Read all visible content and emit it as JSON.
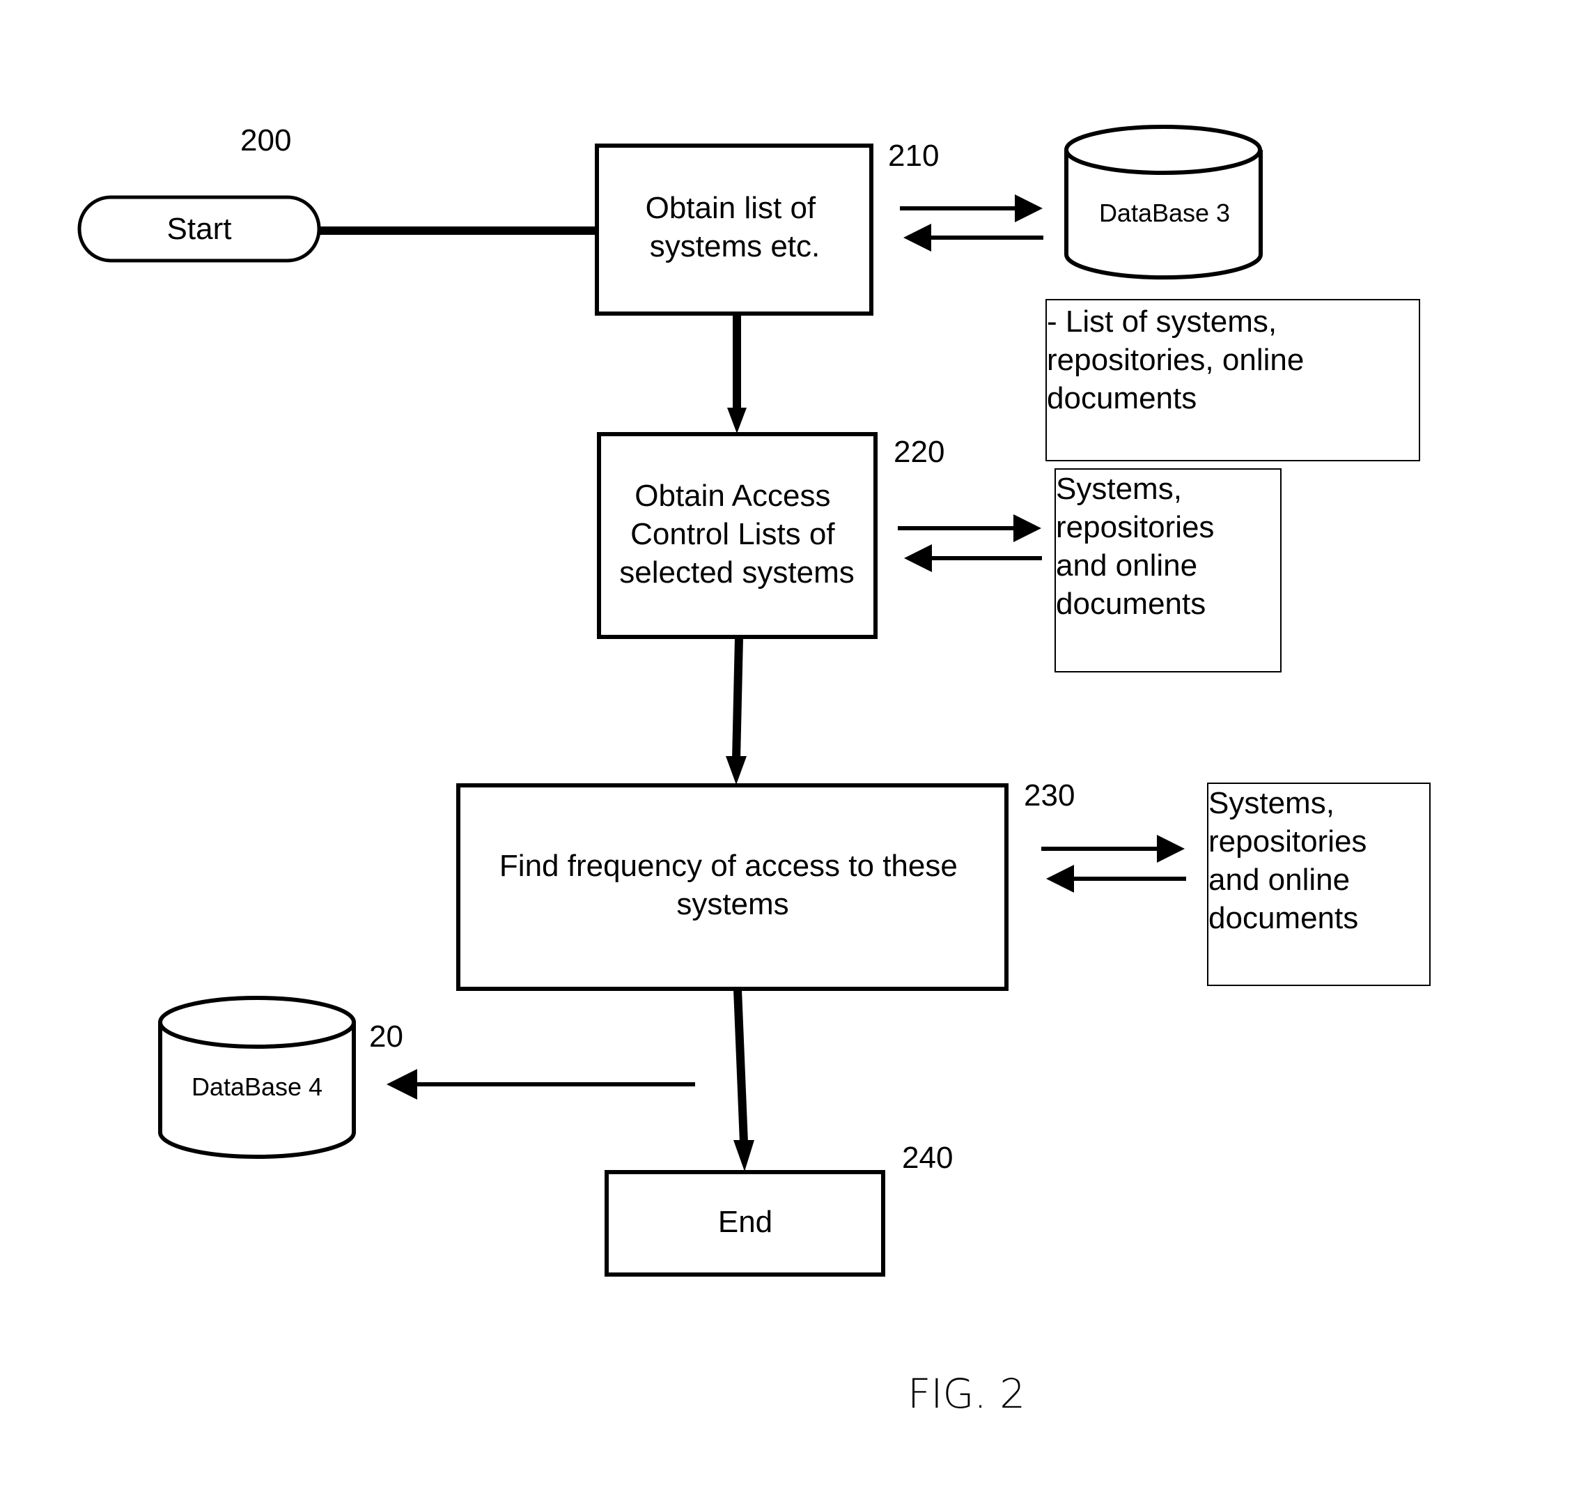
{
  "figure": {
    "caption": "FIG. 2",
    "diagram_ref": "200"
  },
  "nodes": {
    "start": {
      "label": "Start"
    },
    "step210": {
      "ref": "210",
      "lines": [
        "Obtain list of",
        "systems etc."
      ]
    },
    "step220": {
      "ref": "220",
      "lines": [
        "Obtain Access",
        "Control Lists of",
        "selected systems"
      ]
    },
    "step230": {
      "ref": "230",
      "lines": [
        "Find frequency of access to these",
        "systems"
      ]
    },
    "end": {
      "ref": "240",
      "label": "End"
    }
  },
  "databases": {
    "db3": {
      "label": "DataBase 3"
    },
    "db4": {
      "label": "DataBase 4",
      "ref": "20"
    }
  },
  "notes": {
    "note210": {
      "lines": [
        "- List of systems,",
        "repositories, online",
        "documents"
      ]
    },
    "note220": {
      "lines": [
        "Systems,",
        "repositories",
        "and online",
        "documents"
      ]
    },
    "note230": {
      "lines": [
        "Systems,",
        "repositories",
        "and online",
        "documents"
      ]
    }
  }
}
